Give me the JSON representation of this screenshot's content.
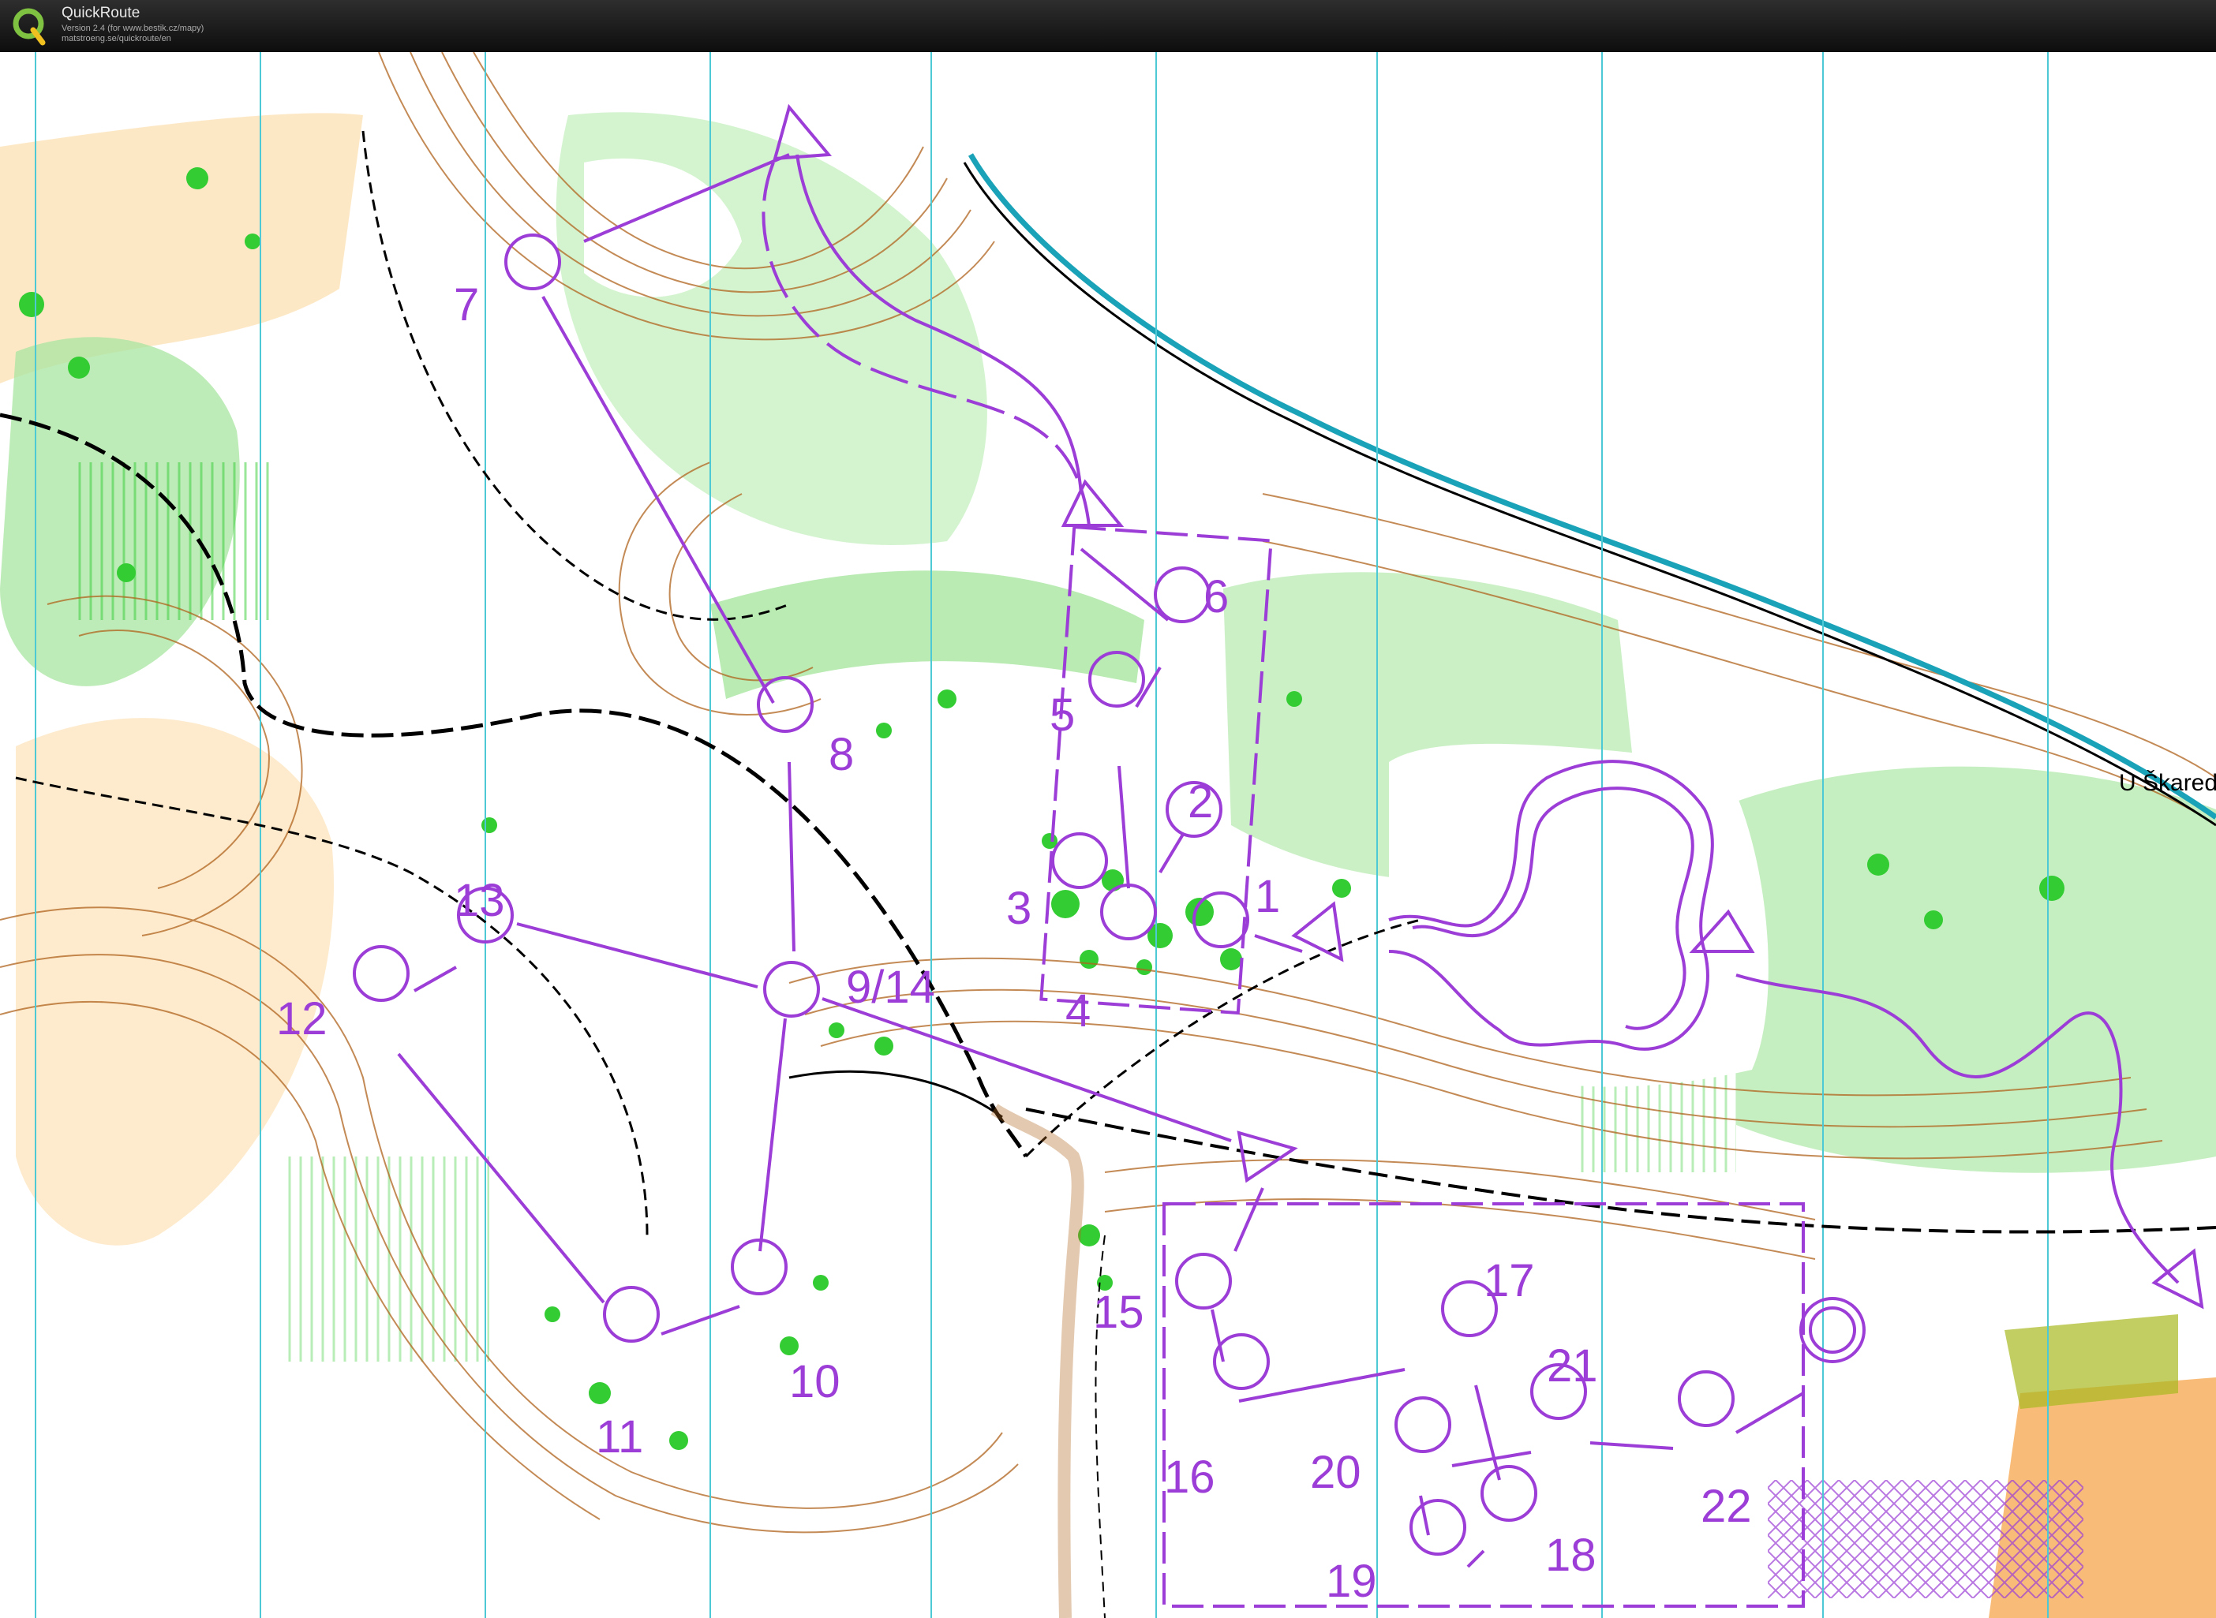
{
  "app": {
    "title": "QuickRoute",
    "version": "Version 2.4  (for www.bestik.cz/mapy)",
    "url": "matstroeng.se/quickroute/en",
    "logo_icon": "q-logo-icon"
  },
  "map": {
    "place_name": "U Škared",
    "colors": {
      "course": "#9b3dd6",
      "vegetation": "#33cc33",
      "light_green": "#a8e6a0",
      "open_land": "#fbd39a",
      "contour": "#b0641e",
      "water": "#1aa3b8",
      "track": "#000000",
      "magnetic_north": "#4dc9d6"
    },
    "controls": [
      {
        "label": "1"
      },
      {
        "label": "2"
      },
      {
        "label": "3"
      },
      {
        "label": "4"
      },
      {
        "label": "5"
      },
      {
        "label": "6"
      },
      {
        "label": "7"
      },
      {
        "label": "8"
      },
      {
        "label": "9/14"
      },
      {
        "label": "10"
      },
      {
        "label": "11"
      },
      {
        "label": "12"
      },
      {
        "label": "13"
      },
      {
        "label": "15"
      },
      {
        "label": "16"
      },
      {
        "label": "17"
      },
      {
        "label": "18"
      },
      {
        "label": "19"
      },
      {
        "label": "20"
      },
      {
        "label": "21"
      },
      {
        "label": "22"
      }
    ]
  }
}
